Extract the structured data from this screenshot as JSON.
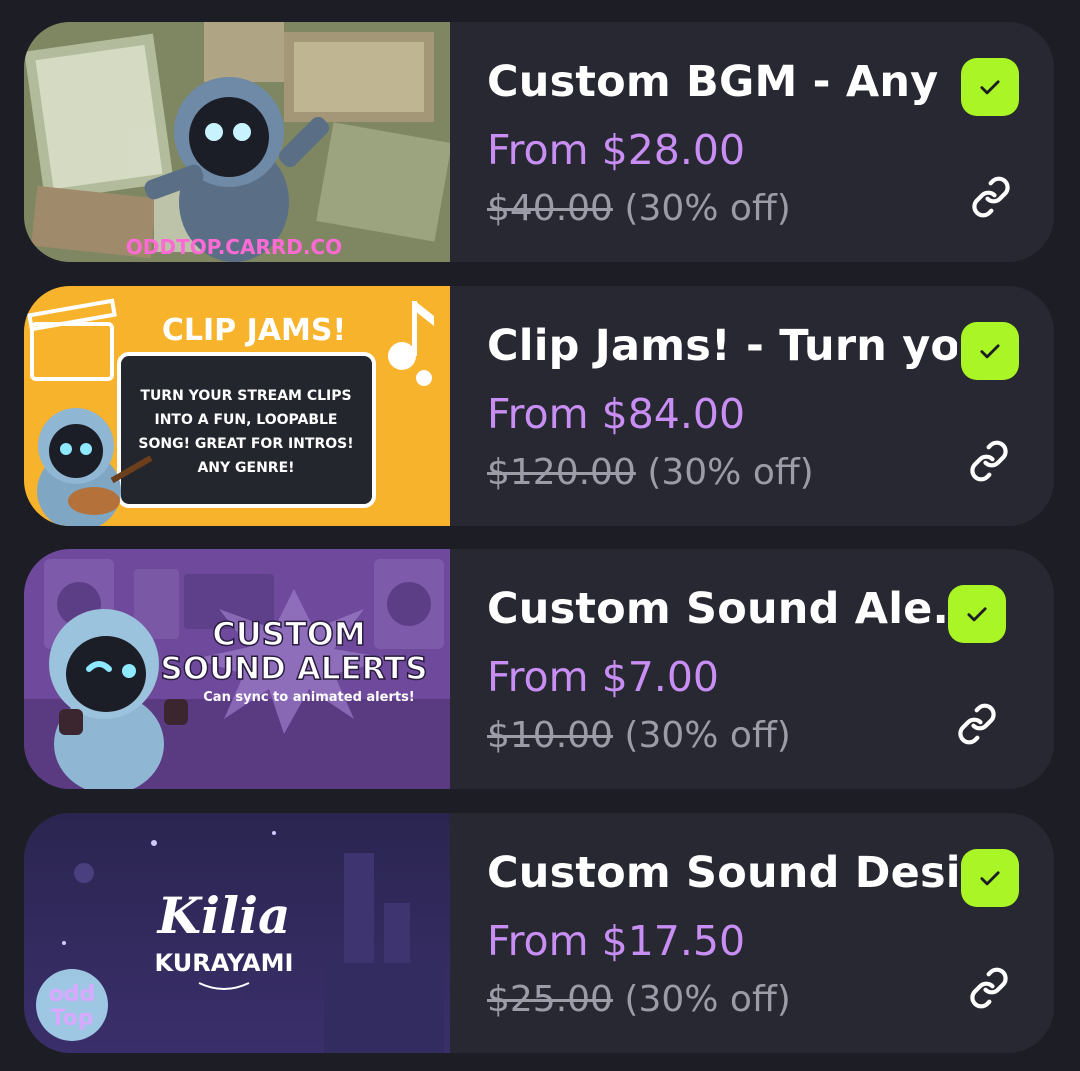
{
  "products": [
    {
      "title": "Custom BGM - Any ...",
      "price": "From $28.00",
      "old_price": "$40.00",
      "discount": "(30% off)",
      "thumb_text": "ODDTOP.CARRD.CO",
      "check_icon": "check-icon",
      "link_icon": "link-icon"
    },
    {
      "title": "Clip Jams! - Turn yo...",
      "price": "From $84.00",
      "old_price": "$120.00",
      "discount": "(30% off)",
      "thumb_heading": "CLIP JAMS!",
      "thumb_lines": [
        "TURN YOUR STREAM CLIPS",
        "INTO A FUN, LOOPABLE",
        "SONG! GREAT FOR INTROS!",
        "ANY GENRE!"
      ],
      "check_icon": "check-icon",
      "link_icon": "link-icon"
    },
    {
      "title": "Custom Sound Ale...",
      "price": "From $7.00",
      "old_price": "$10.00",
      "discount": "(30% off)",
      "thumb_heading_1": "CUSTOM",
      "thumb_heading_2": "SOUND ALERTS",
      "thumb_sub": "Can sync to animated alerts!",
      "check_icon": "check-icon",
      "link_icon": "link-icon"
    },
    {
      "title": "Custom Sound Desi...",
      "price": "From $17.50",
      "old_price": "$25.00",
      "discount": "(30% off)",
      "thumb_logo_1": "Kilia",
      "thumb_logo_2": "KURAYAMI",
      "thumb_badge_1": "odd",
      "thumb_badge_2": "Top",
      "check_icon": "check-icon",
      "link_icon": "link-icon"
    }
  ],
  "colors": {
    "background": "#1d1e25",
    "card": "#272831",
    "price": "#c98ef3",
    "check": "#a9f525"
  }
}
